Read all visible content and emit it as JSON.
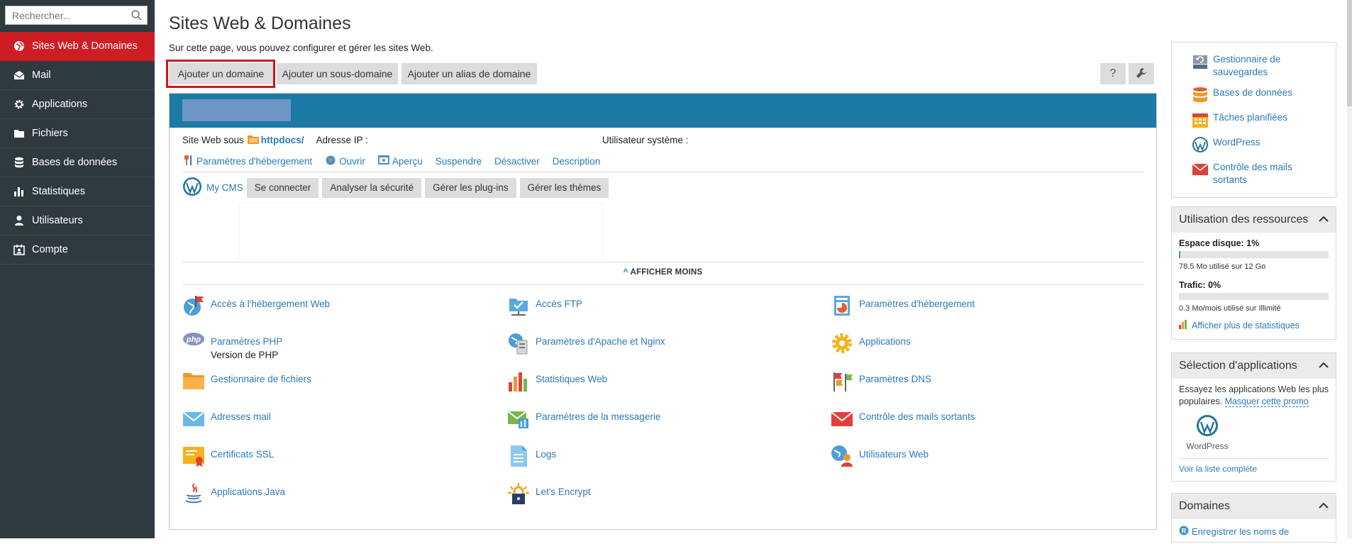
{
  "search": {
    "placeholder": "Rechercher..."
  },
  "sidebar": {
    "items": [
      {
        "label": "Sites Web & Domaines",
        "icon": "globe-icon",
        "active": true
      },
      {
        "label": "Mail",
        "icon": "mail-icon"
      },
      {
        "label": "Applications",
        "icon": "gear-icon"
      },
      {
        "label": "Fichiers",
        "icon": "folder-icon"
      },
      {
        "label": "Bases de données",
        "icon": "database-icon"
      },
      {
        "label": "Statistiques",
        "icon": "bar-chart-icon"
      },
      {
        "label": "Utilisateurs",
        "icon": "user-icon"
      },
      {
        "label": "Compte",
        "icon": "account-icon"
      }
    ]
  },
  "page": {
    "title": "Sites Web & Domaines",
    "description": "Sur cette page, vous pouvez configurer et gérer les sites Web."
  },
  "toolbar": {
    "add_domain": "Ajouter un domaine",
    "add_subdomain": "Ajouter un sous-domaine",
    "add_alias": "Ajouter un alias de domaine",
    "help": "?"
  },
  "domain": {
    "site_label": "Site Web sous",
    "docroot": "httpdocs/",
    "ip_label": "Adresse IP :",
    "sysuser_label": "Utilisateur système :",
    "actions": [
      "Paramètres d'hébergement",
      "Ouvrir",
      "Aperçu",
      "Suspendre",
      "Désactiver",
      "Description"
    ]
  },
  "cms": {
    "label": "My CMS",
    "buttons": [
      "Se connecter",
      "Analyser la sécurité",
      "Gérer les plug-ins",
      "Gérer les thèmes"
    ]
  },
  "show_less": "AFFICHER MOINS",
  "grid": {
    "items": [
      {
        "label": "Accès à l'hébergement Web",
        "icon": "web-hosting-access-icon"
      },
      {
        "label": "Accès FTP",
        "icon": "ftp-icon"
      },
      {
        "label": "Paramètres d'hébergement",
        "icon": "hosting-settings-icon"
      },
      {
        "label": "Paramètres PHP",
        "icon": "php-icon",
        "sub": "Version de PHP"
      },
      {
        "label": "Paramètres d'Apache et Nginx",
        "icon": "apache-nginx-icon"
      },
      {
        "label": "Applications",
        "icon": "applications-gear-icon"
      },
      {
        "label": "Gestionnaire de fichiers",
        "icon": "file-manager-icon"
      },
      {
        "label": "Statistiques Web",
        "icon": "web-stats-icon"
      },
      {
        "label": "Paramètres DNS",
        "icon": "dns-icon"
      },
      {
        "label": "Adresses mail",
        "icon": "mail-addresses-icon"
      },
      {
        "label": "Paramètres de la messagerie",
        "icon": "mail-settings-icon"
      },
      {
        "label": "Contrôle des mails sortants",
        "icon": "outgoing-mail-icon"
      },
      {
        "label": "Certificats SSL",
        "icon": "ssl-certificate-icon"
      },
      {
        "label": "Logs",
        "icon": "logs-icon"
      },
      {
        "label": "Utilisateurs Web",
        "icon": "web-users-icon"
      },
      {
        "label": "Applications Java",
        "icon": "java-icon"
      },
      {
        "label": "Let's Encrypt",
        "icon": "lets-encrypt-icon"
      }
    ]
  },
  "right": {
    "tools": [
      {
        "label": "Gestionnaire de sauvegardes",
        "icon": "backup-icon"
      },
      {
        "label": "Bases de données",
        "icon": "database-icon"
      },
      {
        "label": "Tâches planifiées",
        "icon": "calendar-icon"
      },
      {
        "label": "WordPress",
        "icon": "wordpress-icon"
      },
      {
        "label": "Contrôle des mails sortants",
        "icon": "outgoing-mail-icon"
      }
    ],
    "resources": {
      "title": "Utilisation des ressources",
      "disk_label": "Espace disque: 1%",
      "disk_detail": "78.5 Mo utilisé sur 12 Go",
      "disk_usage": 0.01,
      "traffic_label": "Trafic: 0%",
      "traffic_detail": "0.3 Mo/mois utilisé sur Illimité",
      "traffic_usage": 0,
      "more_stats": "Afficher plus de statistiques"
    },
    "apps": {
      "title": "Sélection d'applications",
      "text": "Essayez les applications Web les plus populaires.",
      "hide_promo": "Masquer cette promo",
      "app_name": "WordPress",
      "full_list": "Voir la liste complète"
    },
    "domains": {
      "title": "Domaines",
      "register": "Enregistrer les noms de"
    }
  }
}
